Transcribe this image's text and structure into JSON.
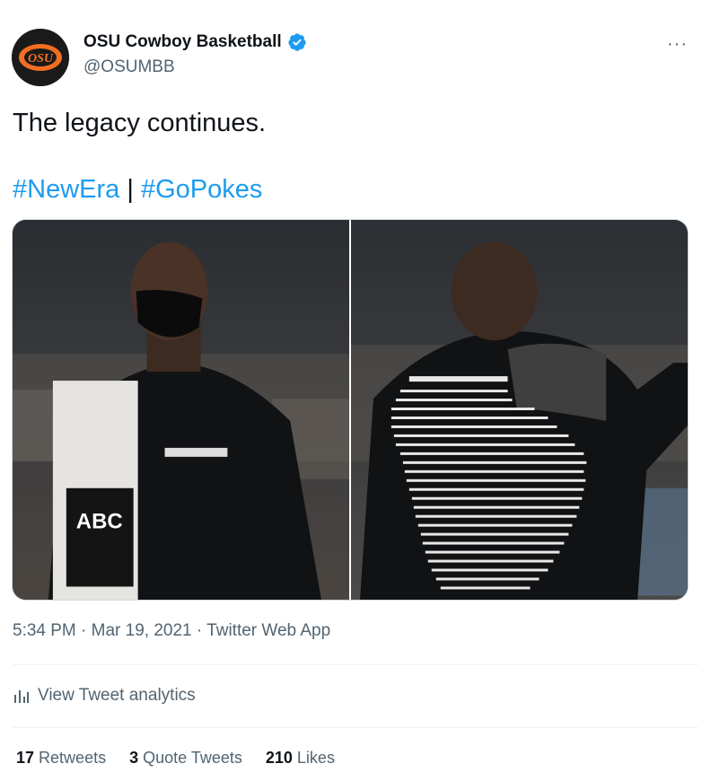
{
  "tweet": {
    "author": {
      "display_name": "OSU Cowboy Basketball",
      "handle": "@OSUMBB",
      "verified": true,
      "avatar_text": "OSU"
    },
    "text": "The legacy continues.",
    "hashtags": [
      "#NewEra",
      "#GoPokes"
    ],
    "hashtag_separator": "|",
    "media": [
      {
        "label": "photo-front"
      },
      {
        "label": "photo-back"
      }
    ],
    "time": "5:34 PM",
    "date": "Mar 19, 2021",
    "source": "Twitter Web App",
    "analytics_label": "View Tweet analytics",
    "stats": {
      "retweets_count": "17",
      "retweets_label": "Retweets",
      "quotes_count": "3",
      "quotes_label": "Quote Tweets",
      "likes_count": "210",
      "likes_label": "Likes"
    },
    "more_glyph": "···"
  },
  "colors": {
    "link": "#1d9bf0",
    "muted": "#536471",
    "brand_orange": "#f36e21"
  }
}
